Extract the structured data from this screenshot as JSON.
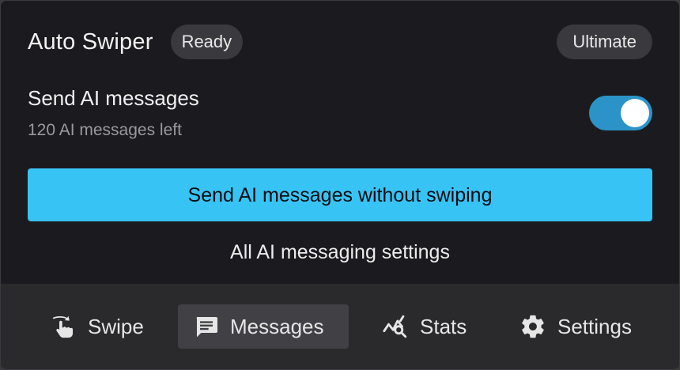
{
  "header": {
    "title": "Auto Swiper",
    "status_badge": "Ready",
    "plan_badge": "Ultimate"
  },
  "ai_messages": {
    "title": "Send AI messages",
    "subtitle": "120 AI messages left",
    "toggle_on": true
  },
  "actions": {
    "primary_button": "Send AI messages without swiping",
    "settings_link": "All AI messaging settings"
  },
  "tabs": [
    {
      "label": "Swipe",
      "icon": "swipe-gesture-icon",
      "active": false
    },
    {
      "label": "Messages",
      "icon": "chat-icon",
      "active": true
    },
    {
      "label": "Stats",
      "icon": "stats-icon",
      "active": false
    },
    {
      "label": "Settings",
      "icon": "gear-icon",
      "active": false
    }
  ],
  "colors": {
    "accent": "#38c3f5",
    "toggle": "#2b93c7",
    "background": "#1b1b1f",
    "tabbar": "#2a2a2d"
  }
}
